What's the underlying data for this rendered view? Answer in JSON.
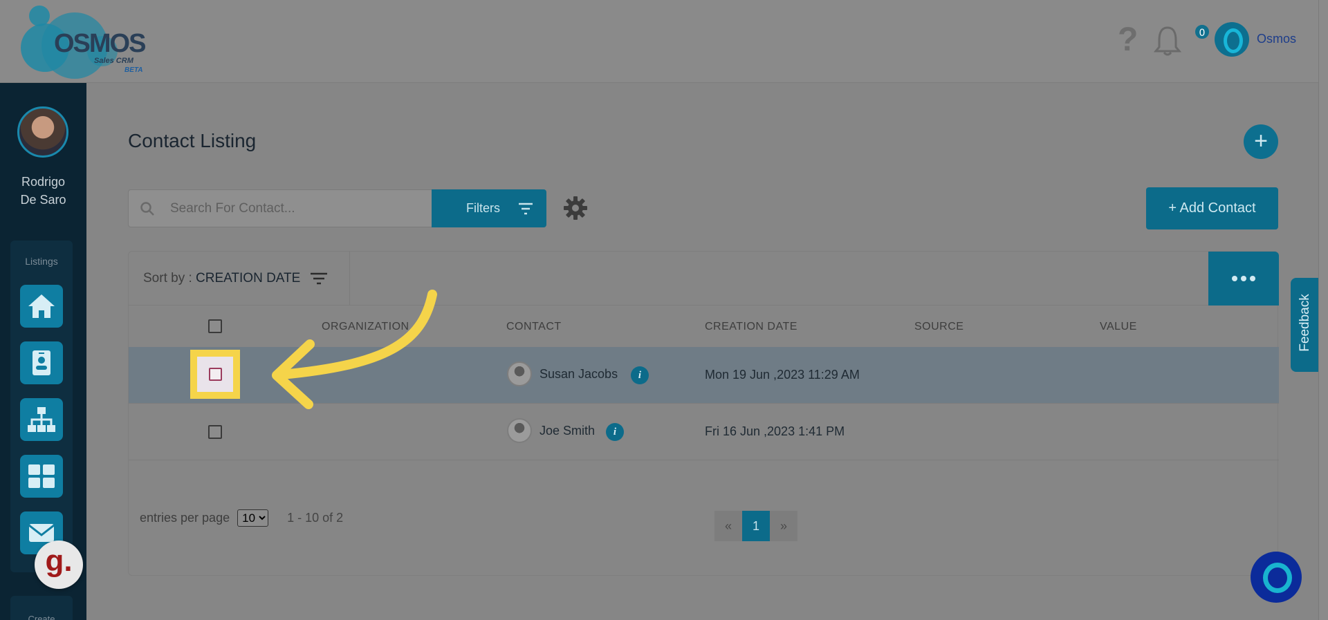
{
  "header": {
    "logo_text": "OSMOS",
    "logo_sub": "Sales CRM",
    "logo_beta": "BETA",
    "help_icon": "question-icon",
    "notif_count": "0",
    "user_name": "Osmos"
  },
  "sidebar": {
    "user_first": "Rodrigo",
    "user_last": "De Saro",
    "section_label": "Listings",
    "items": [
      "home-icon",
      "contact-card-icon",
      "org-chart-icon",
      "grid-icon",
      "mail-icon"
    ],
    "bottom_label": "Create"
  },
  "main": {
    "title": "Contact Listing",
    "search_placeholder": "Search For Contact...",
    "filters_label": "Filters",
    "add_contact_label": "+ Add Contact",
    "sort_prefix": "Sort by :",
    "sort_value": "CREATION DATE",
    "columns": [
      "ORGANIZATION",
      "CONTACT",
      "CREATION DATE",
      "SOURCE",
      "VALUE"
    ],
    "rows": [
      {
        "contact": "Susan Jacobs",
        "creation_date": "Mon 19 Jun ,2023 11:29 AM"
      },
      {
        "contact": "Joe Smith",
        "creation_date": "Fri 16 Jun ,2023 1:41 PM"
      }
    ],
    "entries_label": "entries per page",
    "entries_value": "10",
    "range_text": "1 - 10 of 2",
    "pager": {
      "prev": "«",
      "current": "1",
      "next": "»"
    }
  },
  "feedback_label": "Feedback",
  "grammarly_label": "g.",
  "colors": {
    "accent": "#0c6b8a",
    "highlight": "#f5d44a",
    "sidebar": "#0b2433"
  }
}
